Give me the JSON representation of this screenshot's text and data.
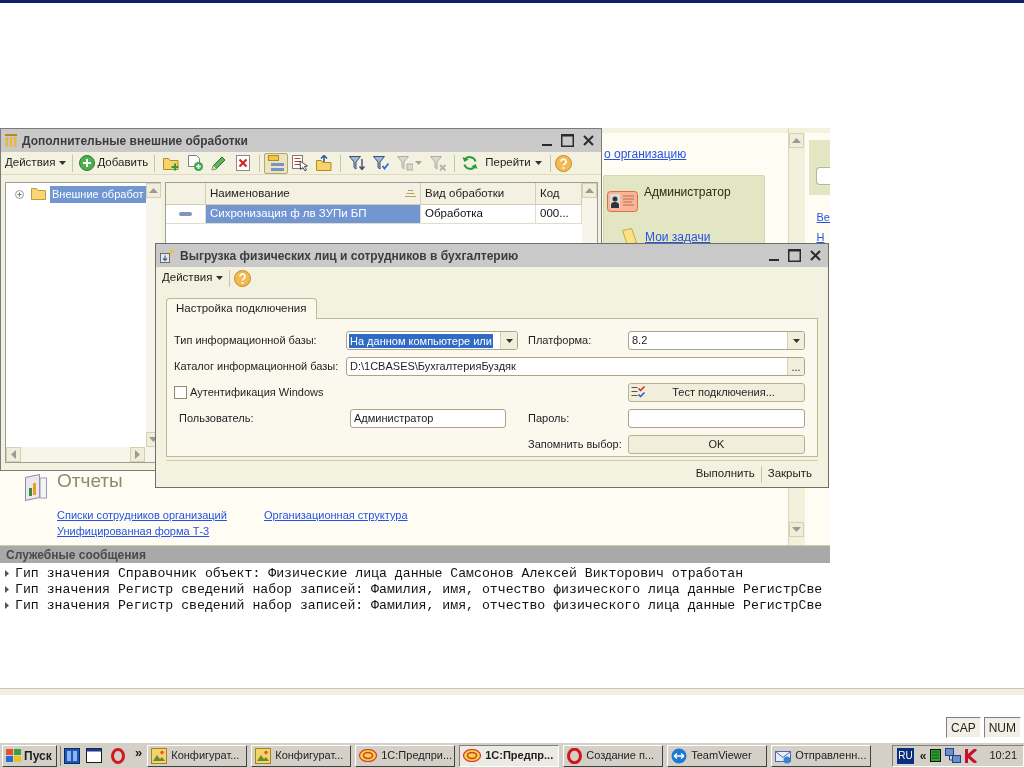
{
  "main_window": {
    "org_link": "о организацию",
    "user_panel": {
      "user": "Администратор",
      "tasks_link": "Мои задачи"
    },
    "side_links": [
      "Ве",
      "Н"
    ],
    "reports": {
      "title": "Отчеты",
      "links": [
        "Списки сотрудников организаций",
        "Организационная структура",
        "Унифицированная форма Т-3"
      ]
    },
    "messages": {
      "title": "Служебные сообщения",
      "lines": [
        "Гип значения Справочник объект: Физические лица данные Самсонов Алексей Викторович отработан",
        "Гип значения Регистр сведений набор записей: Фамилия, имя, отчество физического лица данные РегистрСве",
        "Гип значения Регистр сведений набор записей: Фамилия, имя, отчество физического лица данные РегистрСве"
      ]
    }
  },
  "processing_window": {
    "title": "Дополнительные внешние обработки",
    "toolbar": {
      "actions_menu": "Действия",
      "add_button": "Добавить",
      "icon_groups": [
        [
          {
            "kind": "folder",
            "pressed": false,
            "disabled": false
          },
          {
            "kind": "copy",
            "pressed": false,
            "disabled": false
          },
          {
            "kind": "edit",
            "pressed": false,
            "disabled": false
          },
          {
            "kind": "delete",
            "pressed": false,
            "disabled": false
          }
        ],
        [
          {
            "kind": "tree",
            "pressed": true,
            "disabled": false
          },
          {
            "kind": "select",
            "pressed": false,
            "disabled": false
          },
          {
            "kind": "up",
            "pressed": false,
            "disabled": false
          }
        ],
        [
          {
            "kind": "filter",
            "pressed": false,
            "disabled": false
          },
          {
            "kind": "filtervalue",
            "pressed": false,
            "disabled": false
          },
          {
            "kind": "filterlist",
            "pressed": false,
            "disabled": true
          },
          {
            "kind": "unfilter",
            "pressed": false,
            "disabled": true
          }
        ]
      ],
      "go_menu": "Перейти"
    },
    "tree": [
      {
        "label": "Внешние обработ",
        "selected": true,
        "expanded": false
      }
    ],
    "table": {
      "columns": [
        "Наименование",
        "Вид обработки",
        "Код"
      ],
      "rows": [
        {
          "cells": [
            "Сихронизация ф лв ЗУПи БП",
            "Обработка",
            "000..."
          ],
          "selected": true
        }
      ]
    }
  },
  "dialog": {
    "title": "Выгрузка физических лиц и сотрудников в бухгалтерию",
    "actions_menu": "Действия",
    "tabs": [
      {
        "label": "Настройка подключения",
        "selected": true
      }
    ],
    "base_type": {
      "label": "Тип информационной базы:",
      "value": "На данном компьютере или",
      "highlighted": true
    },
    "platform": {
      "label": "Платформа:",
      "value": "8.2"
    },
    "catalog": {
      "label": "Каталог информационной базы:",
      "value": "D:\\1CBASES\\БухгалтерияБуздяк",
      "select_button": "..."
    },
    "windows_auth": {
      "label": "Аутентификация Windows",
      "checked": false
    },
    "test_button": "Тест подключения...",
    "user": {
      "label": "Пользователь:",
      "value": "Администратор"
    },
    "password": {
      "label": "Пароль:"
    },
    "remember": {
      "label": "Запомнить выбор:",
      "button": "OK"
    },
    "footer_buttons": [
      "Выполнить",
      "Закрыть"
    ]
  },
  "indicators": [
    "CAP",
    "NUM"
  ],
  "taskbar": {
    "start": "Пуск",
    "more": "»",
    "tasks": [
      {
        "kind": "config",
        "label": "Конфигурат...",
        "selected": false
      },
      {
        "kind": "config",
        "label": "Конфигурат...",
        "selected": false
      },
      {
        "kind": "enterprise",
        "label": "1С:Предпри...",
        "selected": false
      },
      {
        "kind": "enterprise",
        "label": "1С:Предпр...",
        "selected": true
      },
      {
        "kind": "browser",
        "label": "Создание п...",
        "selected": false
      },
      {
        "kind": "remote",
        "label": "TeamViewer",
        "selected": false
      },
      {
        "kind": "mail",
        "label": "Отправленн...",
        "selected": false
      }
    ],
    "language": "RU",
    "tray_expand": "«",
    "clock": "10:21"
  }
}
